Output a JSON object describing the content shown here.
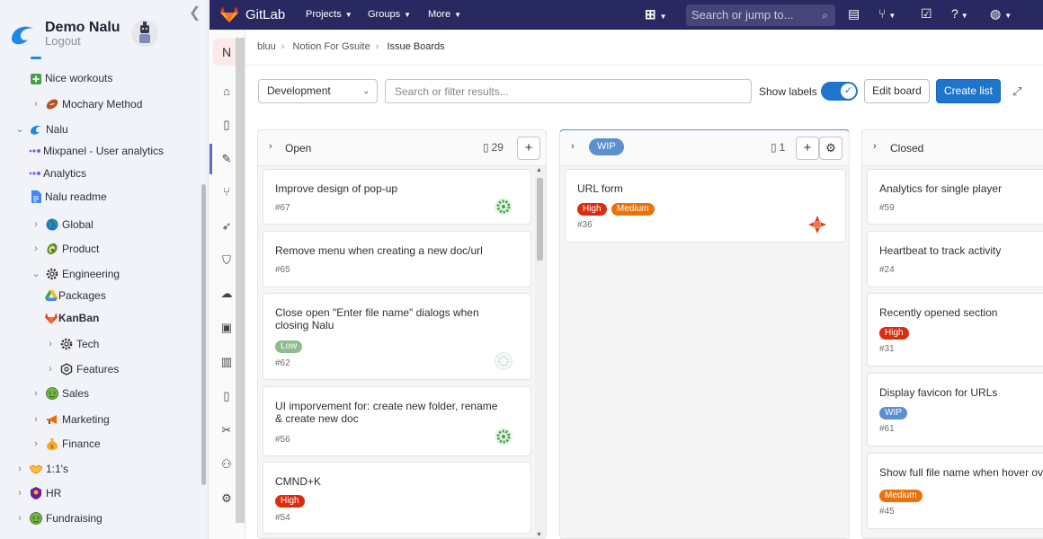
{
  "nalu": {
    "title": "Demo Nalu",
    "logout": "Logout",
    "tree": [
      {
        "label": "Nice workouts",
        "icon": "green-plus-icon",
        "bold": false
      },
      {
        "label": "Mochary Method",
        "icon": "football-icon",
        "bold": false
      },
      {
        "label": "Nalu",
        "icon": "wave-icon",
        "bold": false
      },
      {
        "label": "Mixpanel - User analytics",
        "icon": "mixpanel-dots-icon",
        "bold": false
      },
      {
        "label": "Analytics",
        "icon": "mixpanel-dots-icon",
        "bold": false
      },
      {
        "label": "Nalu readme",
        "icon": "doc-icon",
        "bold": false
      },
      {
        "label": "Global",
        "icon": "globe-icon",
        "bold": false
      },
      {
        "label": "Product",
        "icon": "avocado-icon",
        "bold": false
      },
      {
        "label": "Engineering",
        "icon": "gear-icon",
        "bold": false
      },
      {
        "label": "Packages",
        "icon": "drive-icon",
        "bold": false
      },
      {
        "label": "KanBan",
        "icon": "gitlab-fox-icon",
        "bold": true
      },
      {
        "label": "Tech",
        "icon": "gear-icon",
        "bold": false
      },
      {
        "label": "Features",
        "icon": "gear-outline-icon",
        "bold": false
      },
      {
        "label": "Sales",
        "icon": "money-face-icon",
        "bold": false
      },
      {
        "label": "Marketing",
        "icon": "megaphone-icon",
        "bold": false
      },
      {
        "label": "Finance",
        "icon": "money-bag-icon",
        "bold": false
      },
      {
        "label": "1:1's",
        "icon": "handshake-icon",
        "bold": false
      },
      {
        "label": "HR",
        "icon": "shield-badge-icon",
        "bold": false
      },
      {
        "label": "Fundraising",
        "icon": "money-face-icon",
        "bold": false
      }
    ]
  },
  "topbar": {
    "brand": "GitLab",
    "nav": [
      "Projects",
      "Groups",
      "More"
    ],
    "search_placeholder": "Search or jump to..."
  },
  "rail": {
    "avatar_letter": "N"
  },
  "breadcrumb": [
    "bluu",
    "Notion For Gsuite",
    "Issue Boards"
  ],
  "filters": {
    "board": "Development",
    "search_placeholder": "Search or filter results...",
    "show_labels": "Show labels",
    "show_labels_on": true,
    "edit_board": "Edit board",
    "create_list": "Create list"
  },
  "colors": {
    "high": "#dd2b0e",
    "medium": "#e9720a",
    "low": "#8fbc8f",
    "wip": "#5a8fd0",
    "accent": "#1f75cb",
    "topbar": "#292961"
  },
  "lists": [
    {
      "title": "Open",
      "count": "29",
      "cards": [
        {
          "title": "Improve design of pop-up",
          "number": "#67",
          "labels": []
        },
        {
          "title": "Remove menu when creating a new doc/url",
          "number": "#65",
          "labels": []
        },
        {
          "title": "Close open \"Enter file name\" dialogs when closing Nalu",
          "number": "#62",
          "labels": [
            {
              "text": "Low",
              "color": "#8fbc8f"
            }
          ]
        },
        {
          "title": "UI imporvement for: create new folder, rename & create new doc",
          "number": "#56",
          "labels": []
        },
        {
          "title": "CMND+K",
          "number": "#54",
          "labels": [
            {
              "text": "High",
              "color": "#dd2b0e"
            }
          ]
        }
      ]
    },
    {
      "title": "WIP",
      "count": "1",
      "cards": [
        {
          "title": "URL form",
          "number": "#36",
          "labels": [
            {
              "text": "High",
              "color": "#dd2b0e"
            },
            {
              "text": "Medium",
              "color": "#e9720a"
            }
          ]
        }
      ]
    },
    {
      "title": "Closed",
      "count": "",
      "cards": [
        {
          "title": "Analytics for single player",
          "number": "#59",
          "labels": []
        },
        {
          "title": "Heartbeat to track activity",
          "number": "#24",
          "labels": []
        },
        {
          "title": "Recently opened section",
          "number": "#31",
          "labels": [
            {
              "text": "High",
              "color": "#dd2b0e"
            }
          ]
        },
        {
          "title": "Display favicon for URLs",
          "number": "#61",
          "labels": [
            {
              "text": "WIP",
              "color": "#5a8fd0"
            }
          ]
        },
        {
          "title": "Show full file name when hover ov",
          "number": "#45",
          "labels": [
            {
              "text": "Medium",
              "color": "#e9720a"
            }
          ]
        }
      ]
    }
  ]
}
